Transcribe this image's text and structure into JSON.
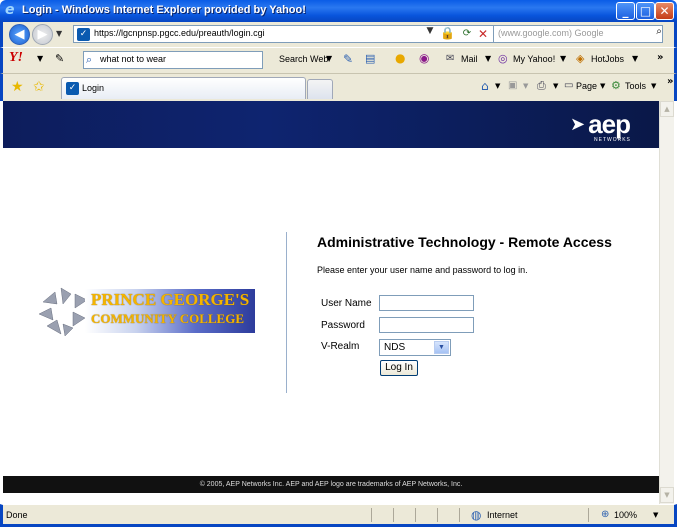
{
  "window": {
    "title": "Login - Windows Internet Explorer provided by Yahoo!"
  },
  "address_bar": {
    "url": "https://lgcnpnsp.pgcc.edu/preauth/login.cgi",
    "search_placeholder": "(www.google.com) Google"
  },
  "yahoo_toolbar": {
    "search_value": "what not to wear",
    "search_web": "Search Web",
    "mail": "Mail",
    "my_yahoo": "My Yahoo!",
    "hotjobs": "HotJobs"
  },
  "tabs": [
    {
      "label": "Login"
    }
  ],
  "command_bar": {
    "page": "Page",
    "tools": "Tools"
  },
  "page": {
    "brand_logo": "aep",
    "brand_sub": "NETWORKS",
    "college_line1": "PRINCE GEORGE'S",
    "college_line2": "COMMUNITY COLLEGE",
    "form_title": "Administrative Technology - Remote Access",
    "instructions": "Please enter your user name and password to log in.",
    "username_label": "User Name",
    "username_value": "",
    "password_label": "Password",
    "realm_label": "V-Realm",
    "realm_value": "NDS",
    "login_button": "Log In",
    "footer": "© 2005, AEP Networks Inc. AEP and AEP logo are trademarks of AEP Networks, Inc."
  },
  "status_bar": {
    "status": "Done",
    "zone": "Internet",
    "zoom": "100%"
  },
  "colors": {
    "titlebar": "#0a5ce6",
    "header_band": "#0e2470",
    "accent_gold": "#f4b400"
  }
}
